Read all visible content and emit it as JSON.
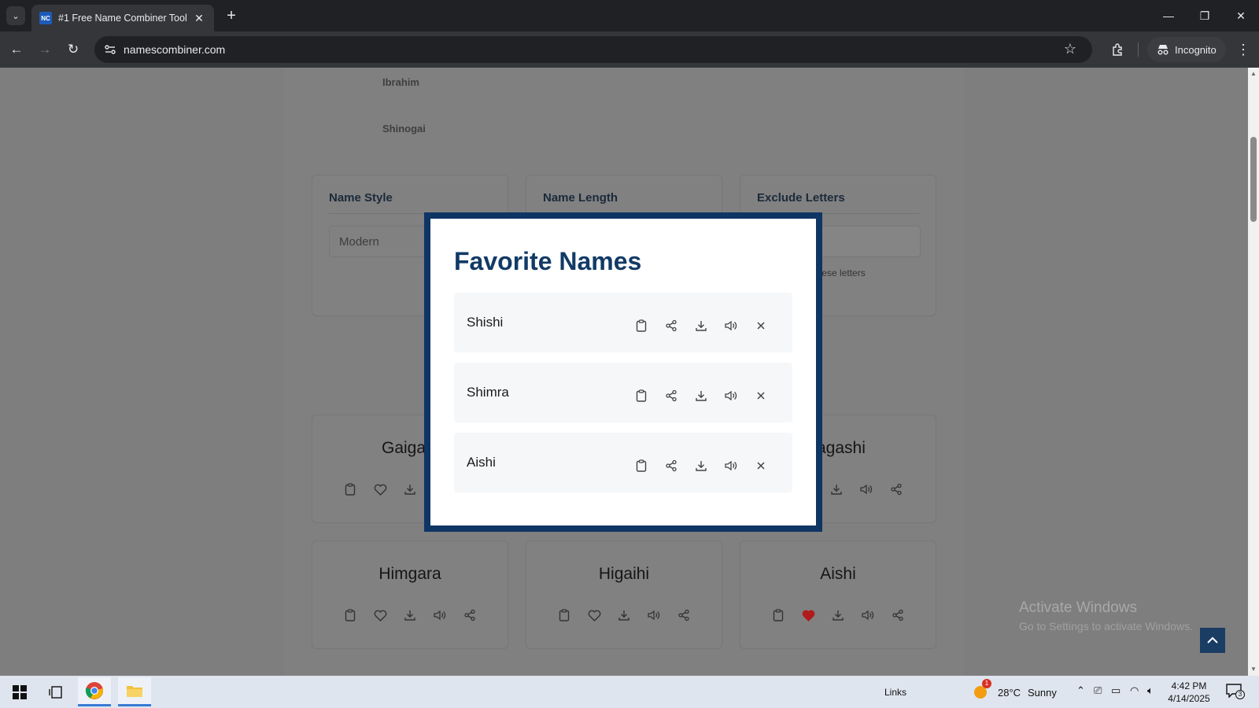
{
  "browser": {
    "tab_title": "#1 Free Name Combiner Tool",
    "favicon_text": "NC",
    "url": "namescombiner.com",
    "incognito_label": "Incognito"
  },
  "page": {
    "faded_names": [
      "Ibrahim",
      "Shinogai"
    ],
    "options": {
      "style": {
        "title": "Name Style",
        "value": "Modern"
      },
      "length": {
        "title": "Name Length"
      },
      "exclude": {
        "title": "Exclude Letters",
        "help": "Don't include these letters"
      }
    },
    "results": [
      {
        "name": "Gaigara",
        "favorite": false
      },
      {
        "name": "",
        "favorite": false
      },
      {
        "name": "Himgashi",
        "favorite": false
      },
      {
        "name": "Himgara",
        "favorite": false
      },
      {
        "name": "Higaihi",
        "favorite": false
      },
      {
        "name": "Aishi",
        "favorite": true
      }
    ],
    "visible_results": {
      "r0": "Gaiga",
      "r2": "agashi",
      "r3": "Himgara",
      "r4": "Higaihi",
      "r5": "Aishi"
    },
    "watermark": {
      "line1": "Activate Windows",
      "line2": "Go to Settings to activate Windows."
    }
  },
  "modal": {
    "title": "Favorite Names",
    "items": [
      {
        "name": "Shishi"
      },
      {
        "name": "Shimra"
      },
      {
        "name": "Aishi"
      }
    ]
  },
  "taskbar": {
    "links_label": "Links",
    "weather_temp": "28°C",
    "weather_text": "Sunny",
    "weather_badge": "1",
    "time": "4:42 PM",
    "date": "4/14/2025",
    "notifications": "3"
  },
  "colors": {
    "modal_border": "#0f3564",
    "title_blue": "#123a66",
    "favorite_heart": "#d32f2f"
  }
}
